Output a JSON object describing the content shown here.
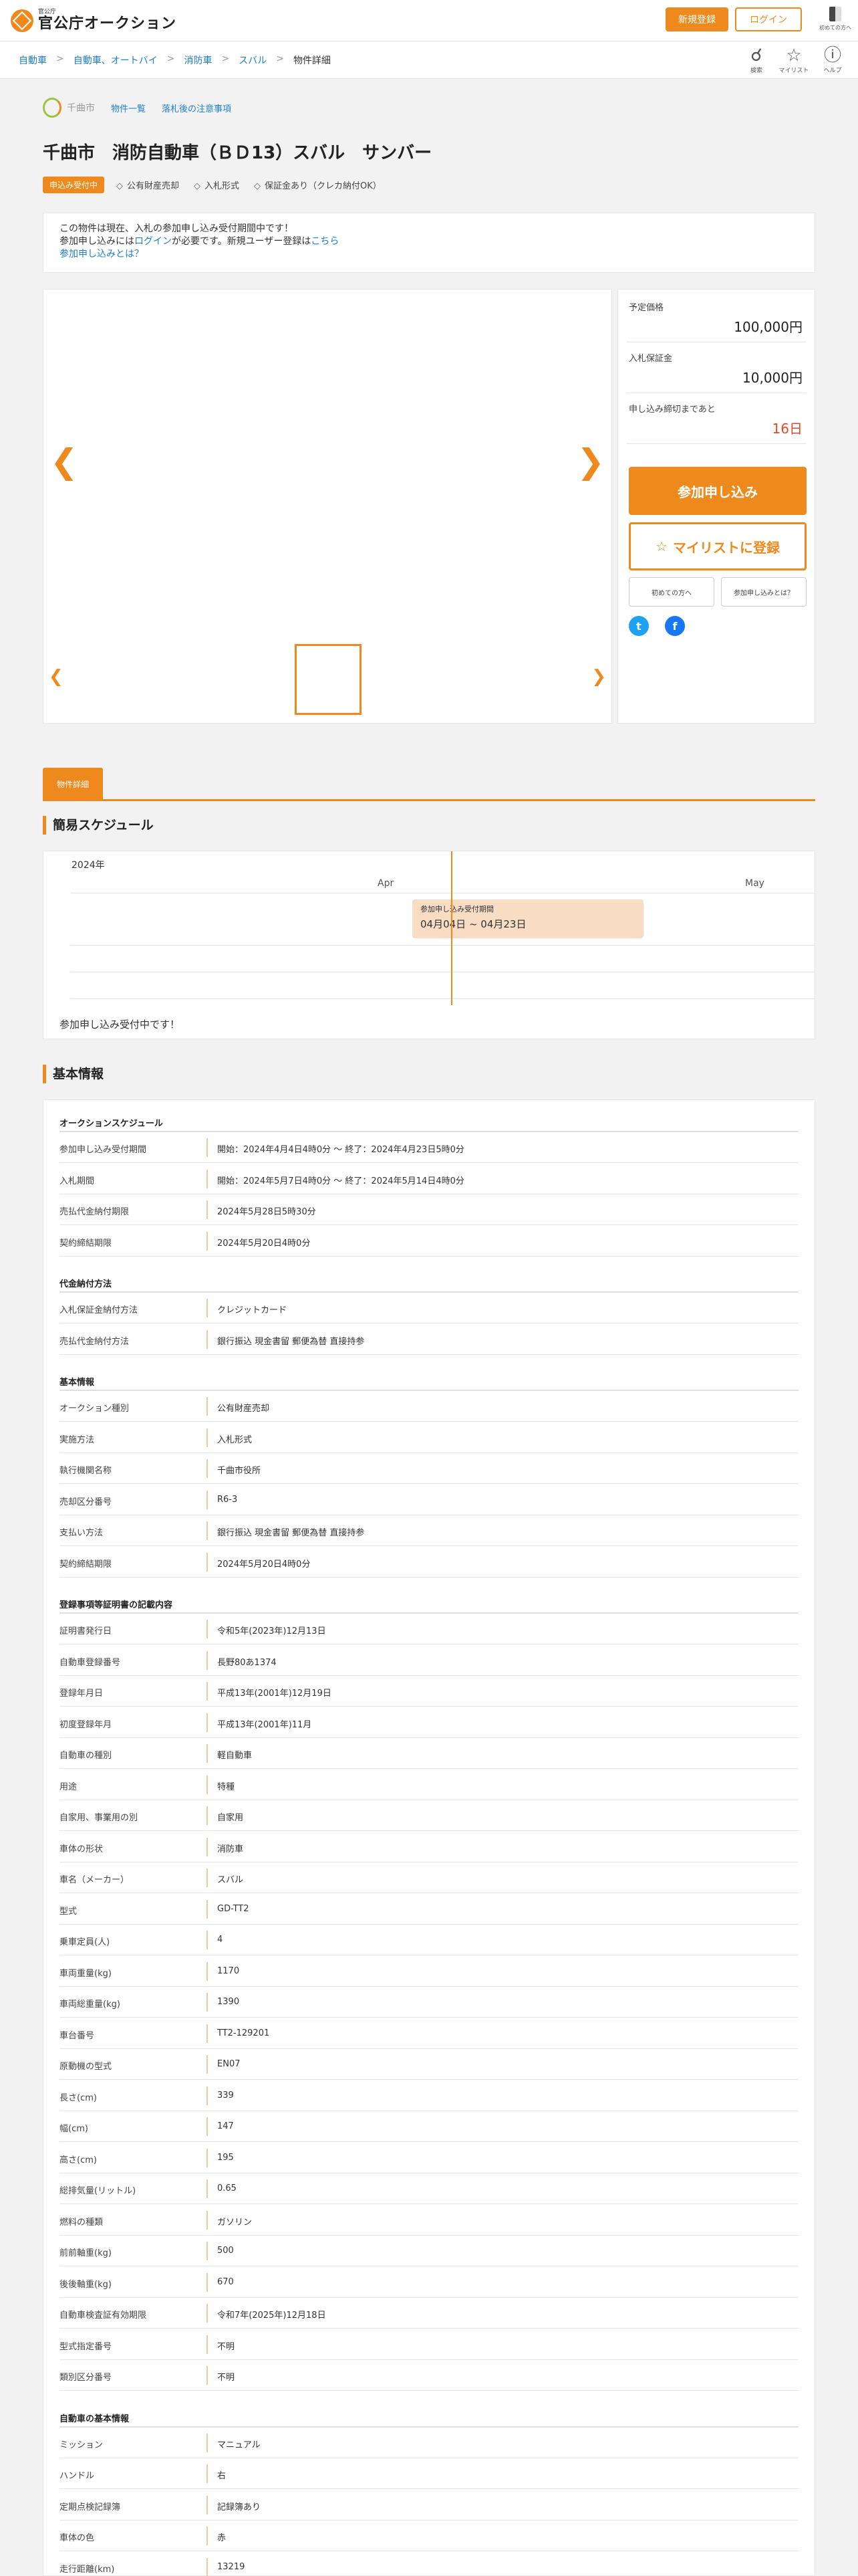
{
  "header": {
    "logo_small": "官公庁",
    "logo_big": "官公庁オークション",
    "signup": "新規登録",
    "login": "ログイン",
    "first_time": "初めての方へ"
  },
  "breadcrumb": [
    "自動車",
    "自動車、オートバイ",
    "消防車",
    "スバル",
    "物件詳細"
  ],
  "topicons": {
    "search": "検索",
    "mylist": "マイリスト",
    "help": "ヘルプ"
  },
  "org": {
    "name": "千曲市",
    "list_link": "物件一覧",
    "notes_link": "落札後の注意事項"
  },
  "title": "千曲市　消防自動車（ＢＤ13）スバル　サンバー",
  "status_badge": "申込み受付中",
  "tags": [
    "公有財産売却",
    "入札形式",
    "保証金あり（クレカ納付OK）"
  ],
  "notice": {
    "line1": "この物件は現在、入札の参加申し込み受付期間中です！",
    "line2a": "参加申し込みには",
    "line2link": "ログイン",
    "line2b": "が必要です。新規ユーザー登録は",
    "line2link2": "こちら",
    "line3link": "参加申し込みとは？"
  },
  "price": {
    "est_label": "予定価格",
    "est_value": "100,000円",
    "deposit_label": "入札保証金",
    "deposit_value": "10,000円",
    "deadline_label": "申し込み締切まであと",
    "deadline_value": "16日",
    "apply": "参加申し込み",
    "mylist": "マイリストに登録",
    "first_btn": "初めての方へ",
    "what_btn": "参加申し込みとは？"
  },
  "tab": "物件詳細",
  "schedule": {
    "title": "簡易スケジュール",
    "year": "2024年",
    "months": [
      "Apr",
      "May"
    ],
    "bar_label": "参加申し込み受付期間",
    "bar_value": "04月04日 ~ 04月23日",
    "status": "参加申し込み受付中です！"
  },
  "info": {
    "title": "基本情報",
    "groups": [
      {
        "name": "オークションスケジュール",
        "rows": [
          [
            "参加申し込み受付期間",
            "開始：2024年4月4日4時0分 ～ 終了：2024年4月23日5時0分"
          ],
          [
            "入札期間",
            "開始：2024年5月7日4時0分 ～ 終了：2024年5月14日4時0分"
          ],
          [
            "売払代金納付期限",
            "2024年5月28日5時30分"
          ],
          [
            "契約締結期限",
            "2024年5月20日4時0分"
          ]
        ]
      },
      {
        "name": "代金納付方法",
        "rows": [
          [
            "入札保証金納付方法",
            "クレジットカード"
          ],
          [
            "売払代金納付方法",
            "銀行振込 現金書留 郵便為替 直接持参"
          ]
        ]
      },
      {
        "name": "基本情報",
        "rows": [
          [
            "オークション種別",
            "公有財産売却"
          ],
          [
            "実施方法",
            "入札形式"
          ],
          [
            "執行機関名称",
            "千曲市役所"
          ],
          [
            "売却区分番号",
            "R6-3"
          ],
          [
            "支払い方法",
            "銀行振込 現金書留 郵便為替 直接持参"
          ],
          [
            "契約締結期限",
            "2024年5月20日4時0分"
          ]
        ]
      },
      {
        "name": "登録事項等証明書の記載内容",
        "rows": [
          [
            "証明書発行日",
            "令和5年(2023年)12月13日"
          ],
          [
            "自動車登録番号",
            "長野80あ1374"
          ],
          [
            "登録年月日",
            "平成13年(2001年)12月19日"
          ],
          [
            "初度登録年月",
            "平成13年(2001年)11月"
          ],
          [
            "自動車の種別",
            "軽自動車"
          ],
          [
            "用途",
            "特種"
          ],
          [
            "自家用、事業用の別",
            "自家用"
          ],
          [
            "車体の形状",
            "消防車"
          ],
          [
            "車名（メーカー）",
            "スバル"
          ],
          [
            "型式",
            "GD-TT2"
          ],
          [
            "乗車定員(人)",
            "4"
          ],
          [
            "車両重量(kg)",
            "1170"
          ],
          [
            "車両総重量(kg)",
            "1390"
          ],
          [
            "車台番号",
            "TT2-129201"
          ],
          [
            "原動機の型式",
            "EN07"
          ],
          [
            "長さ(cm)",
            "339"
          ],
          [
            "幅(cm)",
            "147"
          ],
          [
            "高さ(cm)",
            "195"
          ],
          [
            "総排気量(リットル)",
            "0.65"
          ],
          [
            "燃料の種類",
            "ガソリン"
          ],
          [
            "前前軸重(kg)",
            "500"
          ],
          [
            "後後軸重(kg)",
            "670"
          ],
          [
            "自動車検査証有効期限",
            "令和7年(2025年)12月18日"
          ],
          [
            "型式指定番号",
            "不明"
          ],
          [
            "類別区分番号",
            "不明"
          ]
        ]
      },
      {
        "name": "自動車の基本情報",
        "rows": [
          [
            "ミッション",
            "マニュアル"
          ],
          [
            "ハンドル",
            "右"
          ],
          [
            "定期点検記録簿",
            "記録簿あり"
          ],
          [
            "車体の色",
            "赤"
          ],
          [
            "走行距離(km)",
            "13219"
          ]
        ]
      }
    ]
  }
}
